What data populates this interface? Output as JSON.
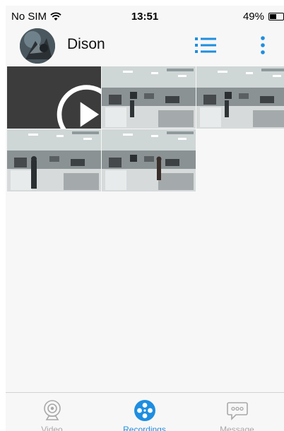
{
  "status_bar": {
    "carrier": "No SIM",
    "time": "13:51",
    "battery": "49%"
  },
  "header": {
    "user_name": "Dison",
    "list_icon": "list-view-icon",
    "more_icon": "more-vertical-icon"
  },
  "recordings": [
    {
      "type": "video-placeholder",
      "icon": "play-icon"
    },
    {
      "type": "thumbnail"
    },
    {
      "type": "thumbnail"
    },
    {
      "type": "thumbnail"
    },
    {
      "type": "thumbnail"
    }
  ],
  "tabs": [
    {
      "label": "Video",
      "icon": "webcam-icon",
      "active": false
    },
    {
      "label": "Recordings",
      "icon": "film-reel-icon",
      "active": true
    },
    {
      "label": "Message",
      "icon": "chat-bubble-icon",
      "active": false
    }
  ],
  "colors": {
    "accent": "#1e8ee0",
    "background": "#f7f7f7",
    "inactive": "#a8a8a8"
  }
}
